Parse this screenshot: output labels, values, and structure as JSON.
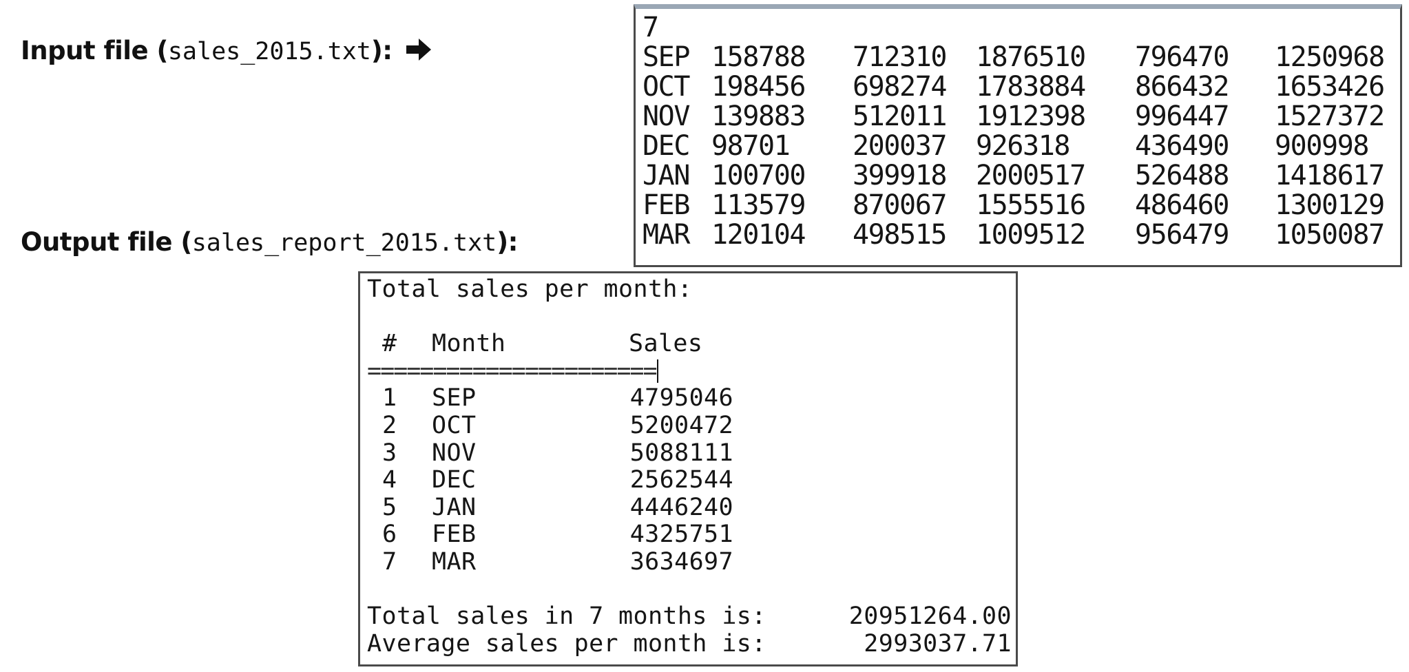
{
  "labels": {
    "input_prefix": "Input file (",
    "input_filename": "sales_2015.txt",
    "input_suffix": "):",
    "output_prefix": "Output file (",
    "output_filename": "sales_report_2015.txt",
    "output_suffix": "):",
    "arrow_icon": "right-arrow-icon"
  },
  "input_file": {
    "count_line": "7",
    "rows": [
      {
        "month": "SEP",
        "values": [
          "158788",
          "712310",
          "1876510",
          "796470",
          "1250968"
        ]
      },
      {
        "month": "OCT",
        "values": [
          "198456",
          "698274",
          "1783884",
          "866432",
          "1653426"
        ]
      },
      {
        "month": "NOV",
        "values": [
          "139883",
          "512011",
          "1912398",
          "996447",
          "1527372"
        ]
      },
      {
        "month": "DEC",
        "values": [
          "98701",
          "200037",
          "926318",
          "436490",
          "900998"
        ]
      },
      {
        "month": "JAN",
        "values": [
          "100700",
          "399918",
          "2000517",
          "526488",
          "1418617"
        ]
      },
      {
        "month": "FEB",
        "values": [
          "113579",
          "870067",
          "1555516",
          "486460",
          "1300129"
        ]
      },
      {
        "month": "MAR",
        "values": [
          "120104",
          "498515",
          "1009512",
          "956479",
          "1050087"
        ]
      }
    ]
  },
  "output_file": {
    "title": "Total sales per month:",
    "header": {
      "num": "#",
      "month": "Month",
      "sales": "Sales"
    },
    "separator": "======================",
    "rows": [
      {
        "num": "1",
        "month": "SEP",
        "sales": "4795046"
      },
      {
        "num": "2",
        "month": "OCT",
        "sales": "5200472"
      },
      {
        "num": "3",
        "month": "NOV",
        "sales": "5088111"
      },
      {
        "num": "4",
        "month": "DEC",
        "sales": "2562544"
      },
      {
        "num": "5",
        "month": "JAN",
        "sales": "4446240"
      },
      {
        "num": "6",
        "month": "FEB",
        "sales": "4325751"
      },
      {
        "num": "7",
        "month": "MAR",
        "sales": "3634697"
      }
    ],
    "total_label": "Total sales in 7 months is:",
    "total_value": "20951264.00",
    "average_label": "Average sales per month is:",
    "average_value": "2993037.71"
  }
}
